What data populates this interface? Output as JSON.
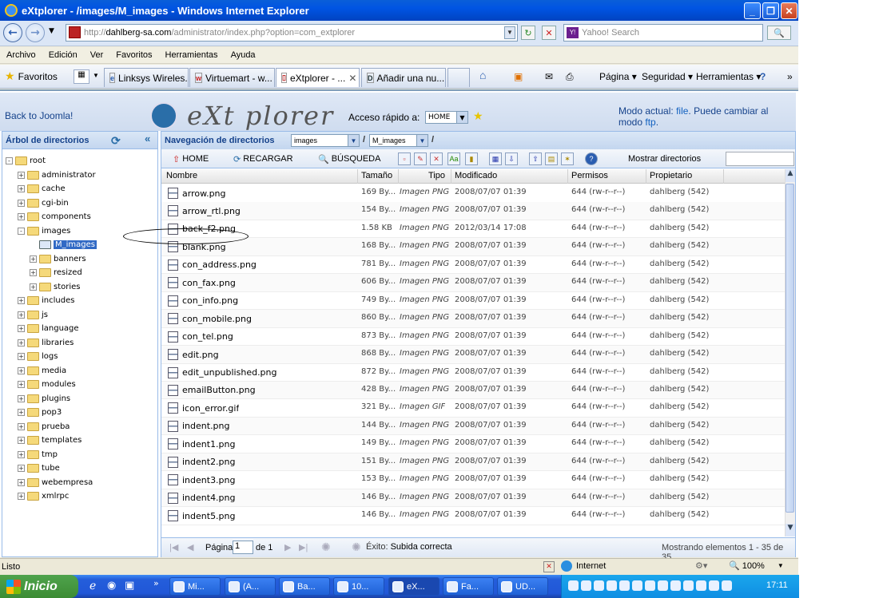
{
  "window": {
    "title": "eXtplorer - /images/M_images - Windows Internet Explorer"
  },
  "address": {
    "protocol": "http://",
    "domain": "dahlberg-sa.com",
    "path": "/administrator/index.php?option=com_extplorer"
  },
  "search": {
    "placeholder": "Yahoo! Search"
  },
  "menu": [
    "Archivo",
    "Edición",
    "Ver",
    "Favoritos",
    "Herramientas",
    "Ayuda"
  ],
  "favbar": {
    "favorites": "Favoritos"
  },
  "tabs": [
    "Linksys Wireles...",
    "Virtuemart - w...",
    "eXtplorer - ...",
    "Añadir una nu..."
  ],
  "commands": [
    "Página ▾",
    "Seguridad ▾",
    "Herramientas ▾"
  ],
  "app": {
    "back_link": "Back to Joomla!",
    "logo": "eXt plorer",
    "quick_access_label": "Acceso rápido a:",
    "quick_access_value": "HOME",
    "mode_prefix": "Modo actual:",
    "mode_current": "file",
    "mode_middle": ". Puede cambiar al modo",
    "mode_switch": "ftp",
    "mode_suffix": "."
  },
  "tree": {
    "title": "Árbol de directorios",
    "nodes": [
      {
        "label": "root",
        "depth": 0,
        "exp": "-"
      },
      {
        "label": "administrator",
        "depth": 1,
        "exp": "+"
      },
      {
        "label": "cache",
        "depth": 1,
        "exp": "+"
      },
      {
        "label": "cgi-bin",
        "depth": 1,
        "exp": "+"
      },
      {
        "label": "components",
        "depth": 1,
        "exp": "+"
      },
      {
        "label": "images",
        "depth": 1,
        "exp": "-"
      },
      {
        "label": "M_images",
        "depth": 2,
        "exp": "",
        "selected": true
      },
      {
        "label": "banners",
        "depth": 2,
        "exp": "+"
      },
      {
        "label": "resized",
        "depth": 2,
        "exp": "+"
      },
      {
        "label": "stories",
        "depth": 2,
        "exp": "+"
      },
      {
        "label": "includes",
        "depth": 1,
        "exp": "+"
      },
      {
        "label": "js",
        "depth": 1,
        "exp": "+"
      },
      {
        "label": "language",
        "depth": 1,
        "exp": "+"
      },
      {
        "label": "libraries",
        "depth": 1,
        "exp": "+"
      },
      {
        "label": "logs",
        "depth": 1,
        "exp": "+"
      },
      {
        "label": "media",
        "depth": 1,
        "exp": "+"
      },
      {
        "label": "modules",
        "depth": 1,
        "exp": "+"
      },
      {
        "label": "plugins",
        "depth": 1,
        "exp": "+"
      },
      {
        "label": "pop3",
        "depth": 1,
        "exp": "+"
      },
      {
        "label": "prueba",
        "depth": 1,
        "exp": "+"
      },
      {
        "label": "templates",
        "depth": 1,
        "exp": "+"
      },
      {
        "label": "tmp",
        "depth": 1,
        "exp": "+"
      },
      {
        "label": "tube",
        "depth": 1,
        "exp": "+"
      },
      {
        "label": "webempresa",
        "depth": 1,
        "exp": "+"
      },
      {
        "label": "xmlrpc",
        "depth": 1,
        "exp": "+"
      }
    ]
  },
  "files": {
    "nav_label": "Navegación de directorios",
    "path": [
      "images",
      "M_images"
    ],
    "toolbar": {
      "home": "HOME",
      "reload": "RECARGAR",
      "search": "BÚSQUEDA",
      "show_dirs": "Mostrar directorios"
    },
    "columns": [
      "Nombre",
      "Tamaño",
      "Tipo",
      "Modificado",
      "Permisos",
      "Propietario"
    ],
    "rows": [
      [
        "arrow.png",
        "169 By...",
        "Imagen PNG",
        "2008/07/07 01:39",
        "644 (rw-r--r--)",
        "dahlberg (542)"
      ],
      [
        "arrow_rtl.png",
        "154 By...",
        "Imagen PNG",
        "2008/07/07 01:39",
        "644 (rw-r--r--)",
        "dahlberg (542)"
      ],
      [
        "back_f2.png",
        "1.58 KB",
        "Imagen PNG",
        "2012/03/14 17:08",
        "644 (rw-r--r--)",
        "dahlberg (542)"
      ],
      [
        "blank.png",
        "168 By...",
        "Imagen PNG",
        "2008/07/07 01:39",
        "644 (rw-r--r--)",
        "dahlberg (542)"
      ],
      [
        "con_address.png",
        "781 By...",
        "Imagen PNG",
        "2008/07/07 01:39",
        "644 (rw-r--r--)",
        "dahlberg (542)"
      ],
      [
        "con_fax.png",
        "606 By...",
        "Imagen PNG",
        "2008/07/07 01:39",
        "644 (rw-r--r--)",
        "dahlberg (542)"
      ],
      [
        "con_info.png",
        "749 By...",
        "Imagen PNG",
        "2008/07/07 01:39",
        "644 (rw-r--r--)",
        "dahlberg (542)"
      ],
      [
        "con_mobile.png",
        "860 By...",
        "Imagen PNG",
        "2008/07/07 01:39",
        "644 (rw-r--r--)",
        "dahlberg (542)"
      ],
      [
        "con_tel.png",
        "873 By...",
        "Imagen PNG",
        "2008/07/07 01:39",
        "644 (rw-r--r--)",
        "dahlberg (542)"
      ],
      [
        "edit.png",
        "868 By...",
        "Imagen PNG",
        "2008/07/07 01:39",
        "644 (rw-r--r--)",
        "dahlberg (542)"
      ],
      [
        "edit_unpublished.png",
        "872 By...",
        "Imagen PNG",
        "2008/07/07 01:39",
        "644 (rw-r--r--)",
        "dahlberg (542)"
      ],
      [
        "emailButton.png",
        "428 By...",
        "Imagen PNG",
        "2008/07/07 01:39",
        "644 (rw-r--r--)",
        "dahlberg (542)"
      ],
      [
        "icon_error.gif",
        "321 By...",
        "Imagen GIF",
        "2008/07/07 01:39",
        "644 (rw-r--r--)",
        "dahlberg (542)"
      ],
      [
        "indent.png",
        "144 By...",
        "Imagen PNG",
        "2008/07/07 01:39",
        "644 (rw-r--r--)",
        "dahlberg (542)"
      ],
      [
        "indent1.png",
        "149 By...",
        "Imagen PNG",
        "2008/07/07 01:39",
        "644 (rw-r--r--)",
        "dahlberg (542)"
      ],
      [
        "indent2.png",
        "151 By...",
        "Imagen PNG",
        "2008/07/07 01:39",
        "644 (rw-r--r--)",
        "dahlberg (542)"
      ],
      [
        "indent3.png",
        "153 By...",
        "Imagen PNG",
        "2008/07/07 01:39",
        "644 (rw-r--r--)",
        "dahlberg (542)"
      ],
      [
        "indent4.png",
        "146 By...",
        "Imagen PNG",
        "2008/07/07 01:39",
        "644 (rw-r--r--)",
        "dahlberg (542)"
      ],
      [
        "indent5.png",
        "146 By...",
        "Imagen PNG",
        "2008/07/07 01:39",
        "644 (rw-r--r--)",
        "dahlberg (542)"
      ]
    ],
    "pager": {
      "page_label": "Página",
      "page": "1",
      "of": "de 1",
      "status_prefix": "Éxito:",
      "status_text": "Subida correcta",
      "summary": "Mostrando elementos 1 - 35 de 35"
    }
  },
  "status": {
    "text": "Listo",
    "zone": "Internet",
    "zoom": "100%"
  },
  "taskbar": {
    "start": "Inicio",
    "buttons": [
      "Mi...",
      "(A...",
      "Ba...",
      "10...",
      "eX...",
      "Fa...",
      "UD..."
    ],
    "active": 4,
    "clock": "17:11"
  }
}
